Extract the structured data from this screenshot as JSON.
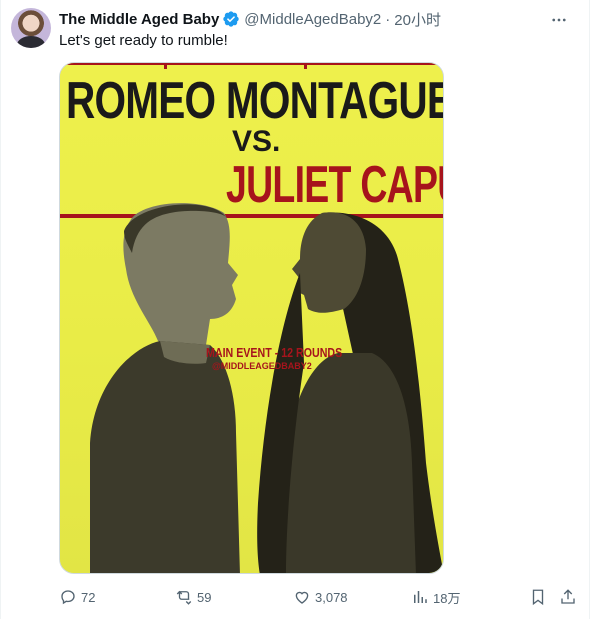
{
  "tweet": {
    "display_name": "The Middle Aged Baby",
    "handle": "@MiddleAgedBaby2",
    "separator": "·",
    "time": "20小时",
    "text": "Let's get ready to rumble!"
  },
  "poster": {
    "title_line1": "ROMEO MONTAGUE",
    "vs": "VS.",
    "title_line2": "JULIET CAPULET",
    "event": "MAIN EVENT - 12 ROUNDS",
    "event_handle": "@MIDDLEAGEDBABY2",
    "colors": {
      "background": "#ecee4a",
      "accent": "#a6141c",
      "ink": "#1a1a1a"
    }
  },
  "actions": {
    "replies": "72",
    "retweets": "59",
    "likes": "3,078",
    "views": "18万"
  },
  "icons": [
    "verified-badge-icon",
    "more-icon",
    "reply-icon",
    "retweet-icon",
    "like-icon",
    "views-icon",
    "bookmark-icon",
    "share-icon"
  ],
  "colors": {
    "verified": "#1d9bf0",
    "muted": "#536471",
    "text": "#0f1419"
  }
}
